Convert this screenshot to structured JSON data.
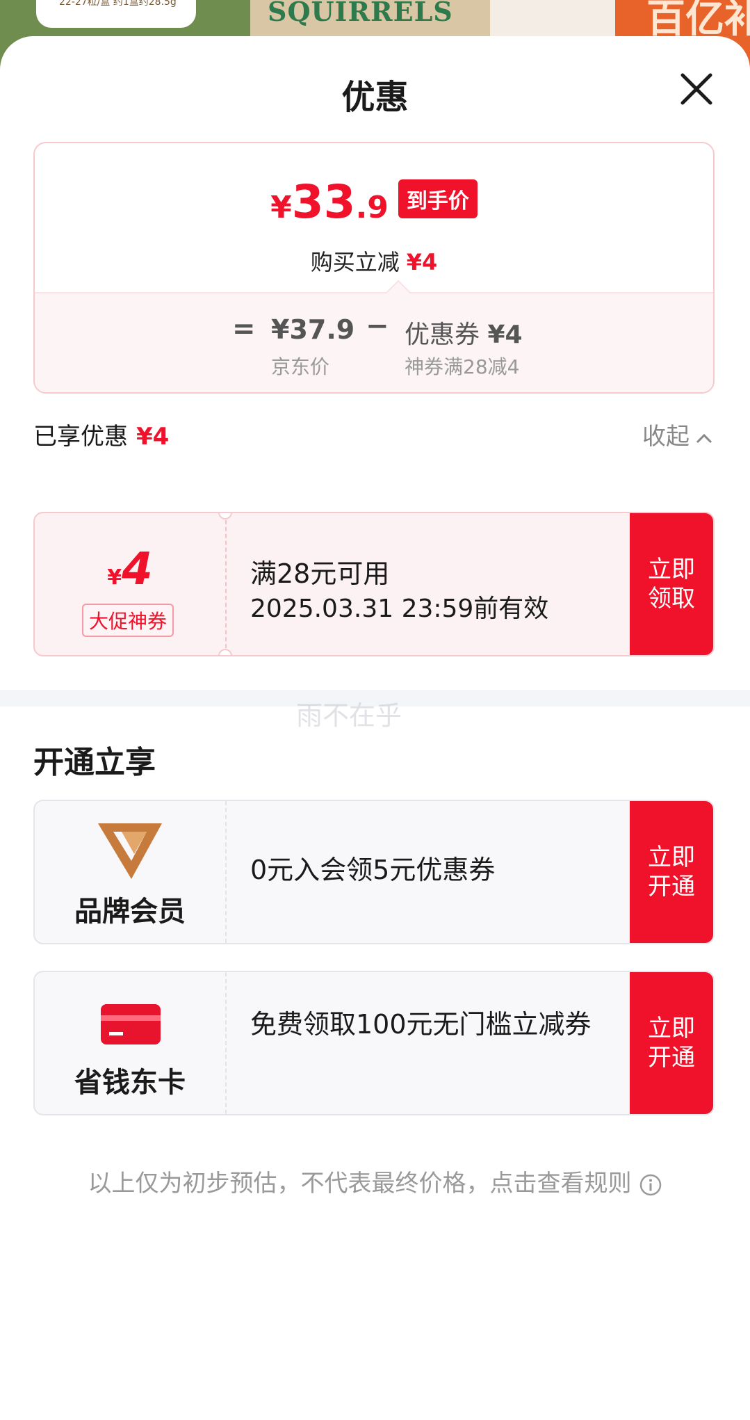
{
  "background": {
    "bubble_text": "22-27粒/盒 约1盒约28.5g",
    "brand_text": "SQUIRRELS",
    "promo_text": "百亿补贴"
  },
  "sheet": {
    "title": "优惠"
  },
  "price_card": {
    "yen": "¥",
    "price_int": "33",
    "price_dec": ".9",
    "final_tag": "到手价",
    "discount_label": "购买立减",
    "discount_value": "¥4",
    "equals": "=",
    "jd_price": "¥37.9",
    "jd_label": "京东价",
    "minus": "−",
    "coupon_label": "优惠券",
    "coupon_value": "¥4",
    "coupon_rule": "神券满28减4"
  },
  "enjoyed": {
    "label": "已享优惠",
    "value": "¥4",
    "collapse_label": "收起"
  },
  "coupon": {
    "yen": "¥",
    "amount": "4",
    "type": "大促神券",
    "condition": "满28元可用",
    "validity": "2025.03.31 23:59前有效",
    "button_line1": "立即",
    "button_line2": "领取"
  },
  "watermark": "雨不在乎",
  "open_section": {
    "title": "开通立享",
    "items": [
      {
        "icon": "brand-member-v-icon",
        "name": "品牌会员",
        "desc": "0元入会领5元优惠券",
        "button_line1": "立即",
        "button_line2": "开通"
      },
      {
        "icon": "card-icon",
        "name": "省钱东卡",
        "desc": "免费领取100元无门槛立减券",
        "button_line1": "立即",
        "button_line2": "开通"
      }
    ]
  },
  "disclaimer": "以上仅为初步预估，不代表最终价格，点击查看规则",
  "colors": {
    "accent_red": "#f0112a",
    "member_gold": "#c67a3c"
  }
}
